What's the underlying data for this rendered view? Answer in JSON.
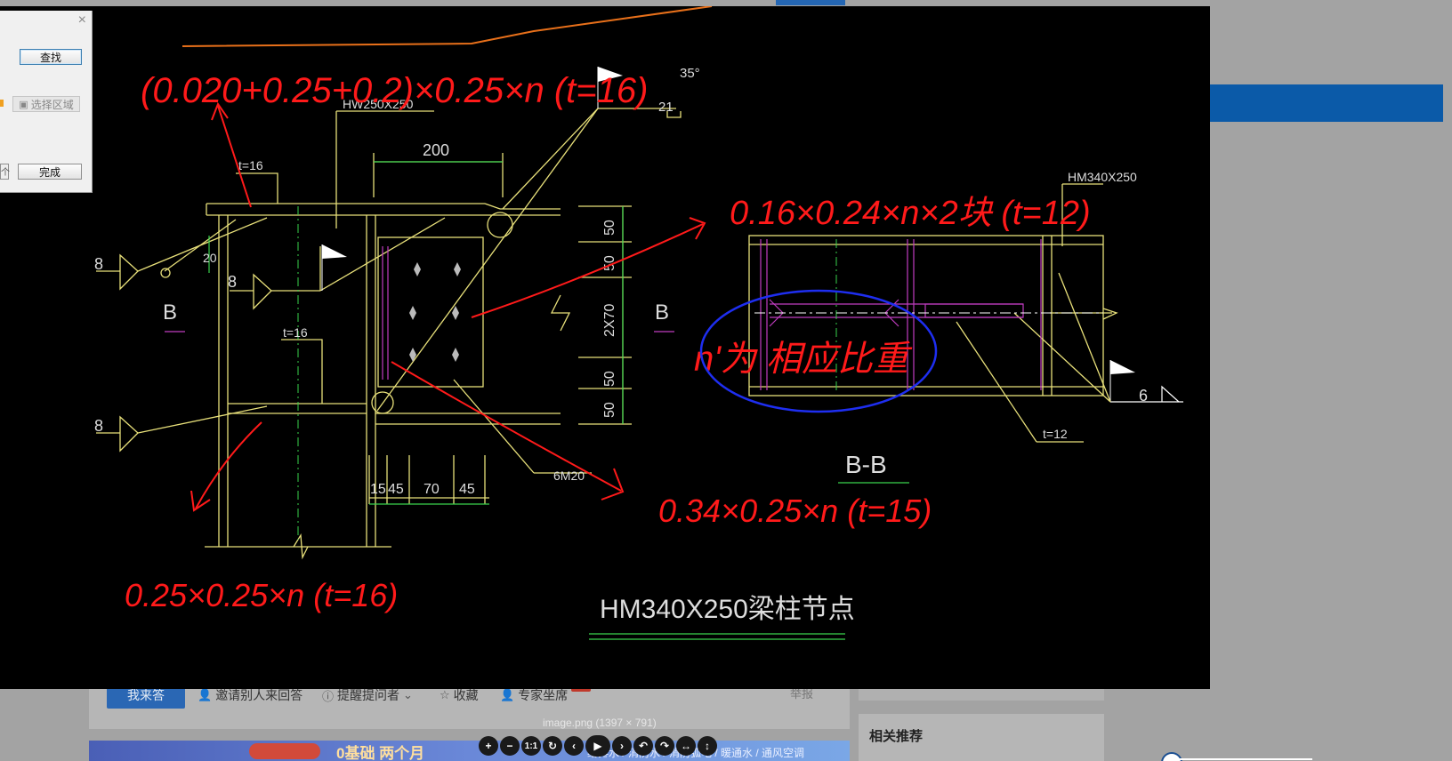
{
  "background_page": {
    "answer_button": "我来答",
    "actions": [
      {
        "icon": "invite-icon",
        "label": "邀请别人来回答",
        "glyph": "👤"
      },
      {
        "icon": "remind-icon",
        "label": "提醒提问者",
        "glyph": "ⓘ"
      },
      {
        "icon": "star-icon",
        "label": "收藏",
        "glyph": "☆"
      },
      {
        "icon": "expert-icon",
        "label": "专家坐席",
        "glyph": "👤"
      }
    ],
    "report": "举报",
    "related_title": "相关推荐",
    "banner_text": "0基础  两个月",
    "banner_sub": "给排水 / 消防水 / 消防弧电 / 暖通水 / 通风空调"
  },
  "find_dialog": {
    "find_button": "查找",
    "select_area_button": "选择区域",
    "finish_button": "完成",
    "close_glyph": "×",
    "left_cut_label": "个"
  },
  "viewer": {
    "caption": "image.png (1397 × 791)",
    "toolbar": [
      {
        "name": "zoom-in-button",
        "glyph": "+"
      },
      {
        "name": "zoom-out-button",
        "glyph": "−"
      },
      {
        "name": "actual-size-button",
        "glyph": "1:1"
      },
      {
        "name": "reset-button",
        "glyph": "↻"
      },
      {
        "name": "prev-button",
        "glyph": "‹"
      },
      {
        "name": "play-button",
        "glyph": "▶"
      },
      {
        "name": "next-button",
        "glyph": "›"
      },
      {
        "name": "rotate-left-button",
        "glyph": "↶"
      },
      {
        "name": "rotate-right-button",
        "glyph": "↷"
      },
      {
        "name": "flip-horizontal-button",
        "glyph": "↔"
      },
      {
        "name": "flip-vertical-button",
        "glyph": "↕"
      }
    ]
  },
  "drawing": {
    "labels": {
      "hw_section": "HW250X250",
      "hm_section": "HM340X250",
      "dim_200": "200",
      "t16_top": "t=16",
      "t16_mid": "t=16",
      "t12": "t=12",
      "weld_20": "20",
      "weld_8a": "8",
      "weld_8b": "8",
      "weld_8c": "8",
      "weld_21": "21",
      "angle_35": "35°",
      "weld_6": "6",
      "section_b_left": "B",
      "section_b_right": "B",
      "section_bb": "B-B",
      "dim_50a": "50",
      "dim_50b": "50",
      "dim_2x70": "2X70",
      "dim_50c": "50",
      "dim_50d": "50",
      "dim_15": "15",
      "dim_45a": "45",
      "dim_70": "70",
      "dim_45b": "45",
      "bolts": "6M20",
      "title": "HM340X250梁柱节点"
    },
    "annotations": {
      "top_formula": "(0.020+0.25+0.2)×0.25×n (t=16)",
      "right_formula": "0.16×0.24×n×2块 (t=12)",
      "circled_note": "n'为 相应比重",
      "middle_formula": "0.34×0.25×n (t=15)",
      "bottom_formula": "0.25×0.25×n (t=16)"
    }
  }
}
